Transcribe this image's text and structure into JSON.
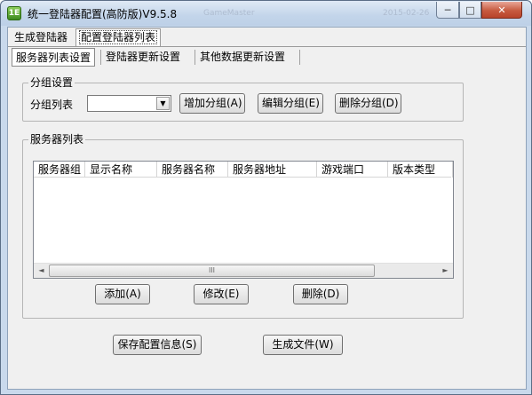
{
  "window": {
    "title": "统一登陆器配置(高防版)V9.5.8",
    "ghost_left": "GameMaster",
    "ghost_right": "2015-02-26",
    "min_glyph": "─",
    "max_glyph": "□",
    "close_glyph": "✕",
    "icon_text": "1E"
  },
  "outer_tabs": [
    "生成登陆器",
    "配置登陆器列表"
  ],
  "inner_tabs": [
    "服务器列表设置",
    "登陆器更新设置",
    "其他数据更新设置"
  ],
  "group_settings": {
    "legend": "分组设置",
    "list_label": "分组列表",
    "combo_value": "",
    "combo_arrow": "▼",
    "add": "增加分组(A)",
    "edit": "编辑分组(E)",
    "delete": "删除分组(D)"
  },
  "server_list": {
    "legend": "服务器列表",
    "columns": [
      "服务器组",
      "显示名称",
      "服务器名称",
      "服务器地址",
      "游戏端口",
      "版本类型"
    ],
    "rows": [],
    "scroll_left": "◄",
    "scroll_right": "►",
    "scroll_grip": "III",
    "add": "添加(A)",
    "modify": "修改(E)",
    "remove": "删除(D)"
  },
  "footer": {
    "save": "保存配置信息(S)",
    "generate": "生成文件(W)"
  }
}
